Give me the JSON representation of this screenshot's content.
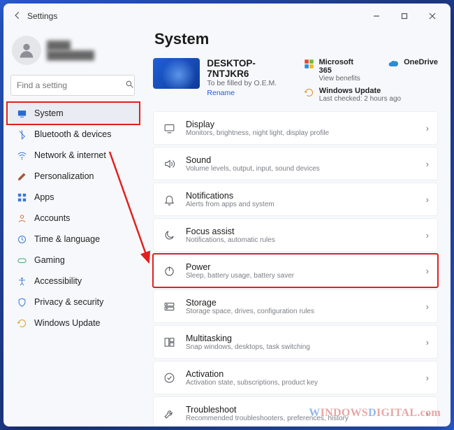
{
  "window": {
    "title": "Settings"
  },
  "profile": {
    "name": "████",
    "email": "████████"
  },
  "search": {
    "placeholder": "Find a setting"
  },
  "sidebar": {
    "items": [
      {
        "label": "System"
      },
      {
        "label": "Bluetooth & devices"
      },
      {
        "label": "Network & internet"
      },
      {
        "label": "Personalization"
      },
      {
        "label": "Apps"
      },
      {
        "label": "Accounts"
      },
      {
        "label": "Time & language"
      },
      {
        "label": "Gaming"
      },
      {
        "label": "Accessibility"
      },
      {
        "label": "Privacy & security"
      },
      {
        "label": "Windows Update"
      }
    ]
  },
  "main": {
    "heading": "System",
    "device": {
      "name": "DESKTOP-7NTJKR6",
      "sub": "To be filled by O.E.M.",
      "rename": "Rename"
    },
    "rc": {
      "ms365": {
        "title": "Microsoft 365",
        "sub": "View benefits"
      },
      "onedrive": {
        "title": "OneDrive",
        "sub": ""
      },
      "wu": {
        "title": "Windows Update",
        "sub": "Last checked: 2 hours ago"
      }
    },
    "cards": [
      {
        "title": "Display",
        "sub": "Monitors, brightness, night light, display profile"
      },
      {
        "title": "Sound",
        "sub": "Volume levels, output, input, sound devices"
      },
      {
        "title": "Notifications",
        "sub": "Alerts from apps and system"
      },
      {
        "title": "Focus assist",
        "sub": "Notifications, automatic rules"
      },
      {
        "title": "Power",
        "sub": "Sleep, battery usage, battery saver"
      },
      {
        "title": "Storage",
        "sub": "Storage space, drives, configuration rules"
      },
      {
        "title": "Multitasking",
        "sub": "Snap windows, desktops, task switching"
      },
      {
        "title": "Activation",
        "sub": "Activation state, subscriptions, product key"
      },
      {
        "title": "Troubleshoot",
        "sub": "Recommended troubleshooters, preferences, history"
      }
    ]
  },
  "watermark": "WindowsDigital.com"
}
